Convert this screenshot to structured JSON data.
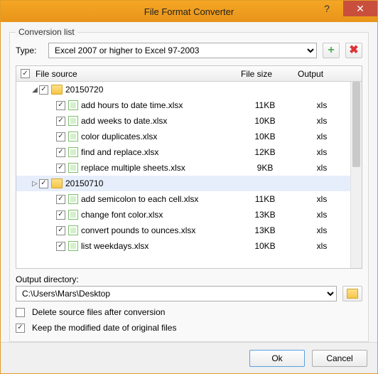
{
  "window": {
    "title": "File Format Converter"
  },
  "group": {
    "legend": "Conversion list"
  },
  "type": {
    "label": "Type:",
    "selected": "Excel 2007 or higher to Excel 97-2003"
  },
  "columns": {
    "source": "File source",
    "size": "File size",
    "output": "Output"
  },
  "tree": {
    "folder1": {
      "name": "20150720",
      "expanded": true
    },
    "folder2": {
      "name": "20150710",
      "expanded": true
    },
    "f1": [
      {
        "name": "add hours to date time.xlsx",
        "size": "11KB",
        "out": "xls"
      },
      {
        "name": "add weeks to date.xlsx",
        "size": "10KB",
        "out": "xls"
      },
      {
        "name": "color duplicates.xlsx",
        "size": "10KB",
        "out": "xls"
      },
      {
        "name": "find and replace.xlsx",
        "size": "12KB",
        "out": "xls"
      },
      {
        "name": "replace multiple sheets.xlsx",
        "size": "9KB",
        "out": "xls"
      }
    ],
    "f2": [
      {
        "name": "add semicolon to each cell.xlsx",
        "size": "11KB",
        "out": "xls"
      },
      {
        "name": "change font color.xlsx",
        "size": "13KB",
        "out": "xls"
      },
      {
        "name": "convert pounds to ounces.xlsx",
        "size": "13KB",
        "out": "xls"
      },
      {
        "name": "list weekdays.xlsx",
        "size": "10KB",
        "out": "xls"
      }
    ]
  },
  "outdir": {
    "label": "Output directory:",
    "value": "C:\\Users\\Mars\\Desktop"
  },
  "options": {
    "delete": {
      "label": "Delete source files after conversion",
      "checked": false
    },
    "keepdate": {
      "label": "Keep the modified date of original files",
      "checked": true
    }
  },
  "buttons": {
    "ok": "Ok",
    "cancel": "Cancel"
  }
}
